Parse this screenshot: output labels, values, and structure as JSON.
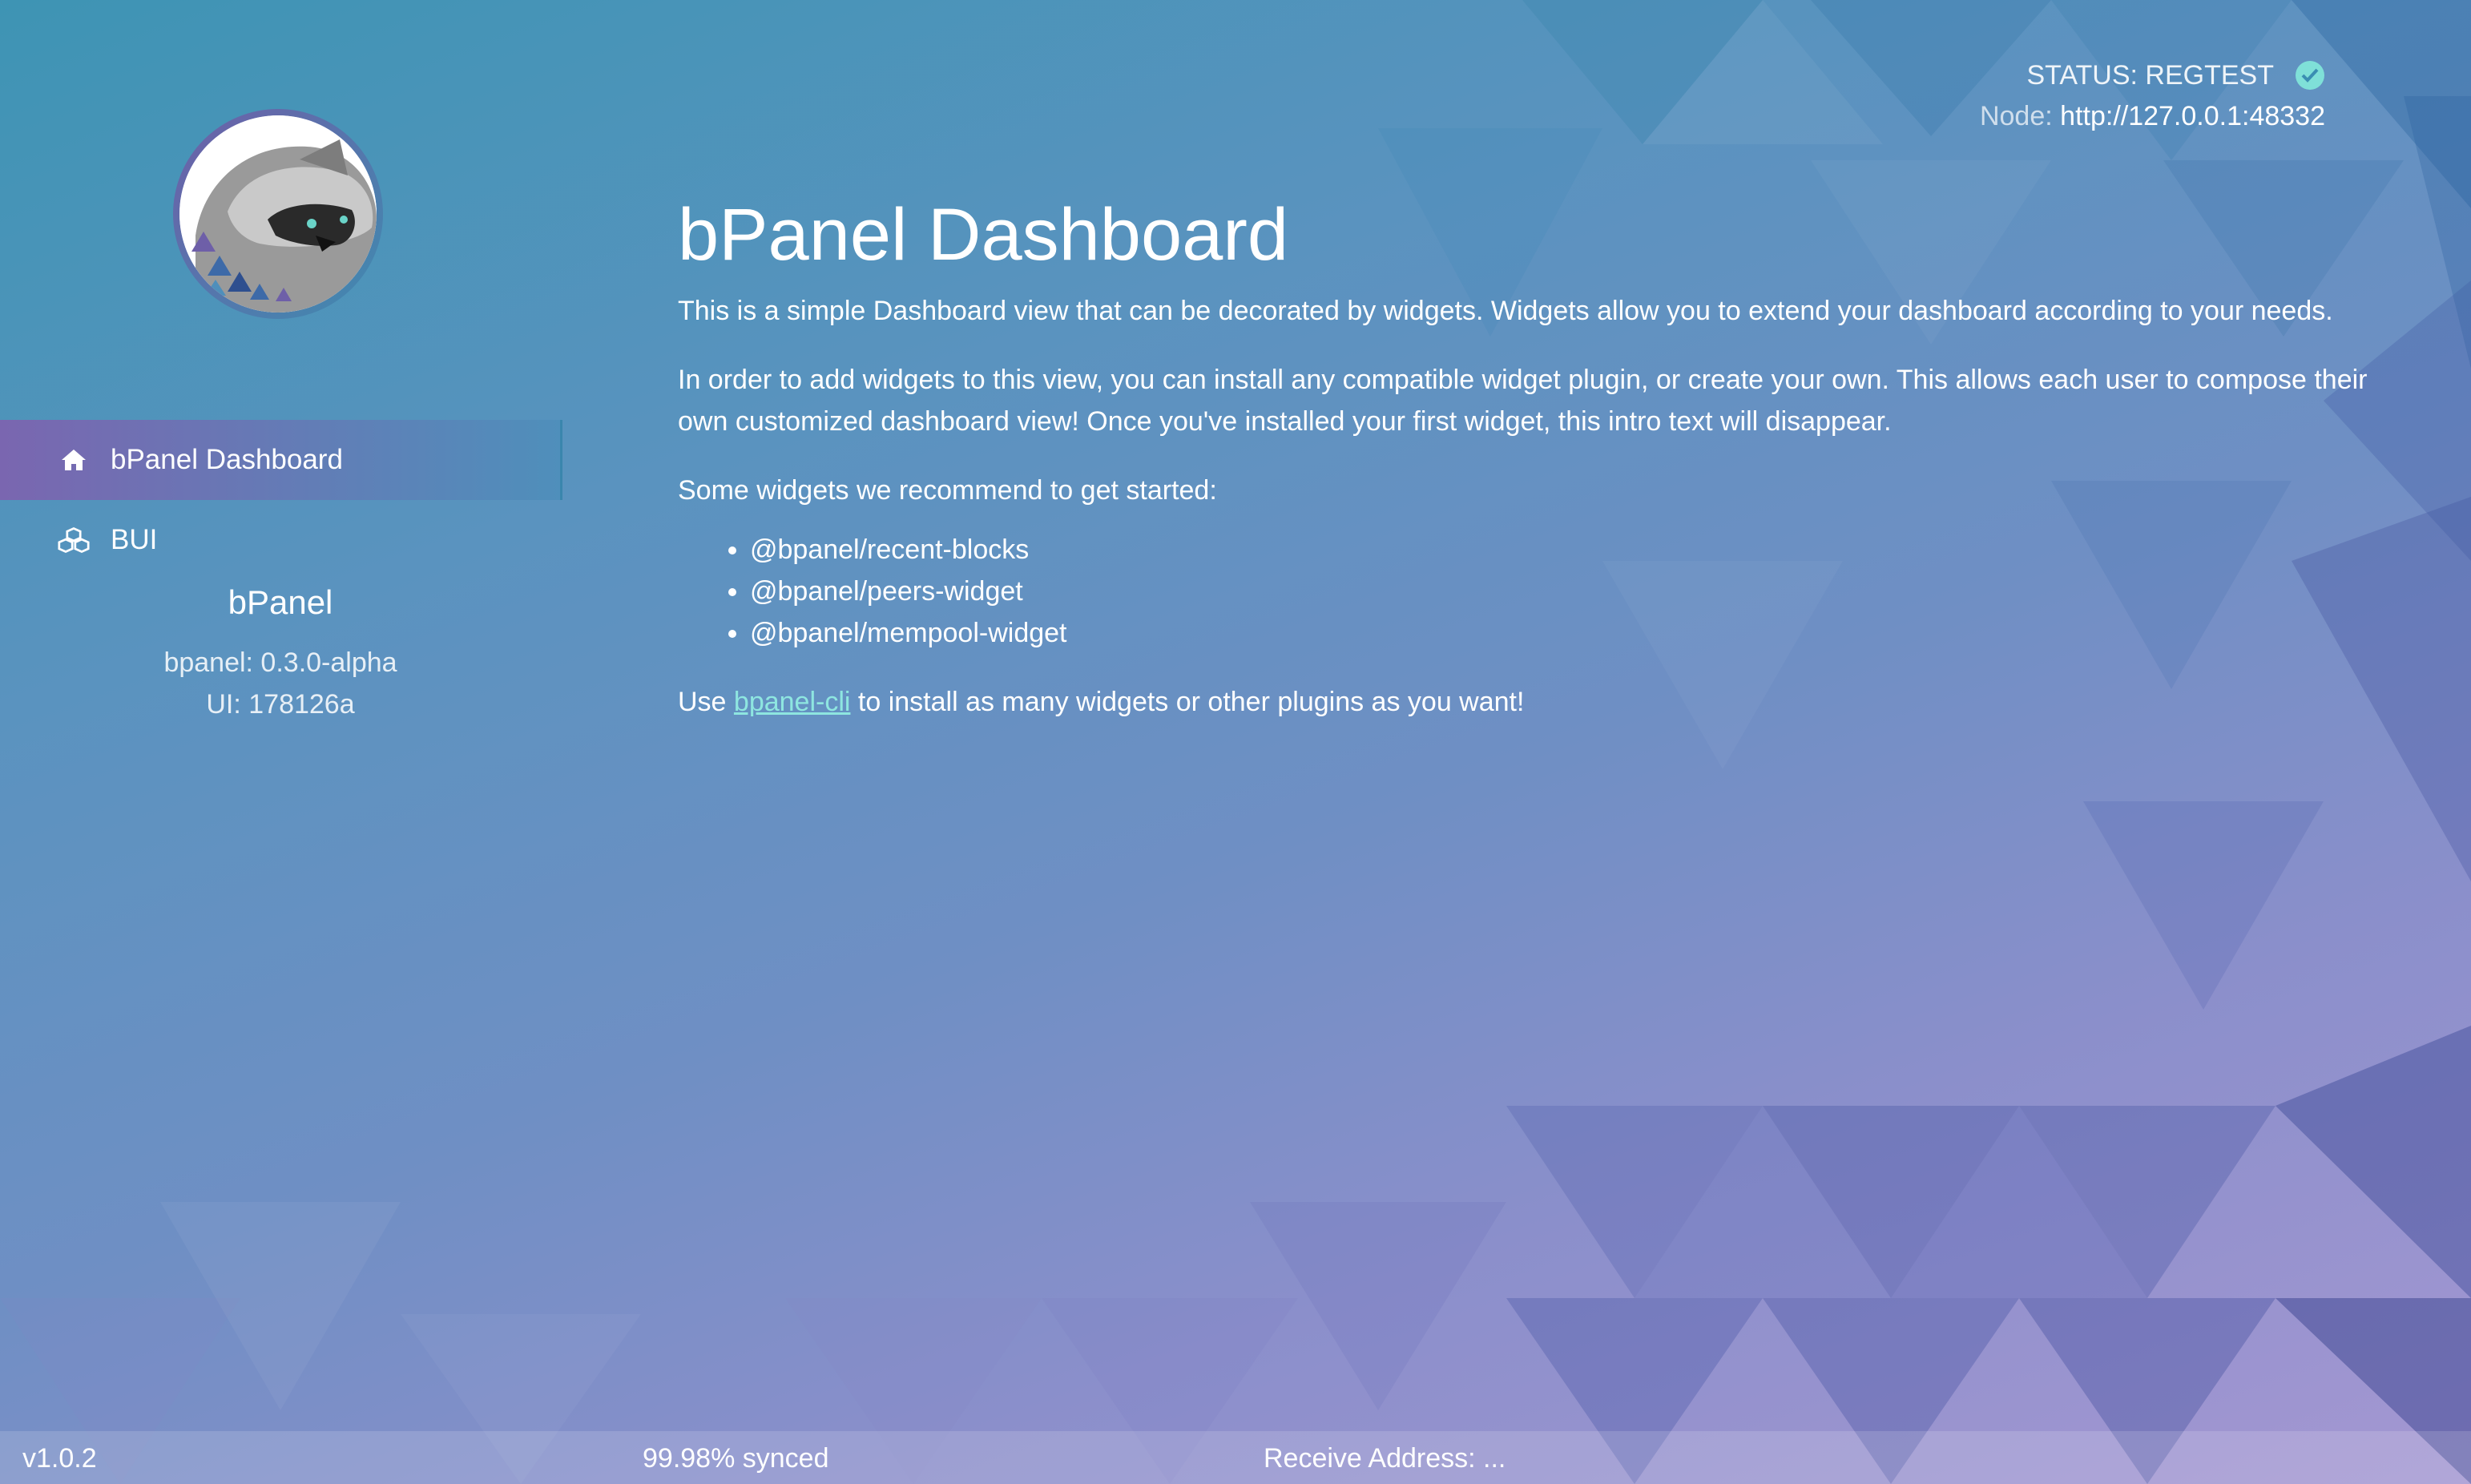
{
  "colors": {
    "background_top": "#3e94b4",
    "background_bottom": "#a497d2",
    "active_nav_start": "#7a66b0",
    "active_nav_end": "#4f8fbb",
    "link": "#8ee6e0",
    "status_check": "#7fe0d8"
  },
  "sidebar": {
    "logo_icon": "raccoon-logo",
    "items": [
      {
        "label": "bPanel Dashboard",
        "icon": "home-icon",
        "active": true
      },
      {
        "label": "BUI",
        "icon": "cubes-icon",
        "active": false
      }
    ],
    "app_name": "bPanel",
    "bpanel_version": "bpanel: 0.3.0-alpha",
    "ui_version": "UI: 178126a"
  },
  "header": {
    "status_text": "STATUS: REGTEST",
    "status_icon": "check-circle-icon",
    "node_label": "Node: ",
    "node_url": "http://127.0.0.1:48332"
  },
  "main": {
    "title": "bPanel Dashboard",
    "intro1": "This is a simple Dashboard view that can be decorated by widgets. Widgets allow you to extend your dashboard according to your needs.",
    "intro2": "In order to add widgets to this view, you can install any compatible widget plugin, or create your own. This allows each user to compose their own customized dashboard view! Once you've installed your first widget, this intro text will disappear.",
    "recommend_heading": "Some widgets we recommend to get started:",
    "widgets": [
      "@bpanel/recent-blocks",
      "@bpanel/peers-widget",
      "@bpanel/mempool-widget"
    ],
    "cli_prefix": "Use ",
    "cli_link": "bpanel-cli",
    "cli_suffix": " to install as many widgets or other plugins as you want!"
  },
  "footer": {
    "version": "v1.0.2",
    "sync": "99.98% synced",
    "receive_address": "Receive Address: ..."
  }
}
